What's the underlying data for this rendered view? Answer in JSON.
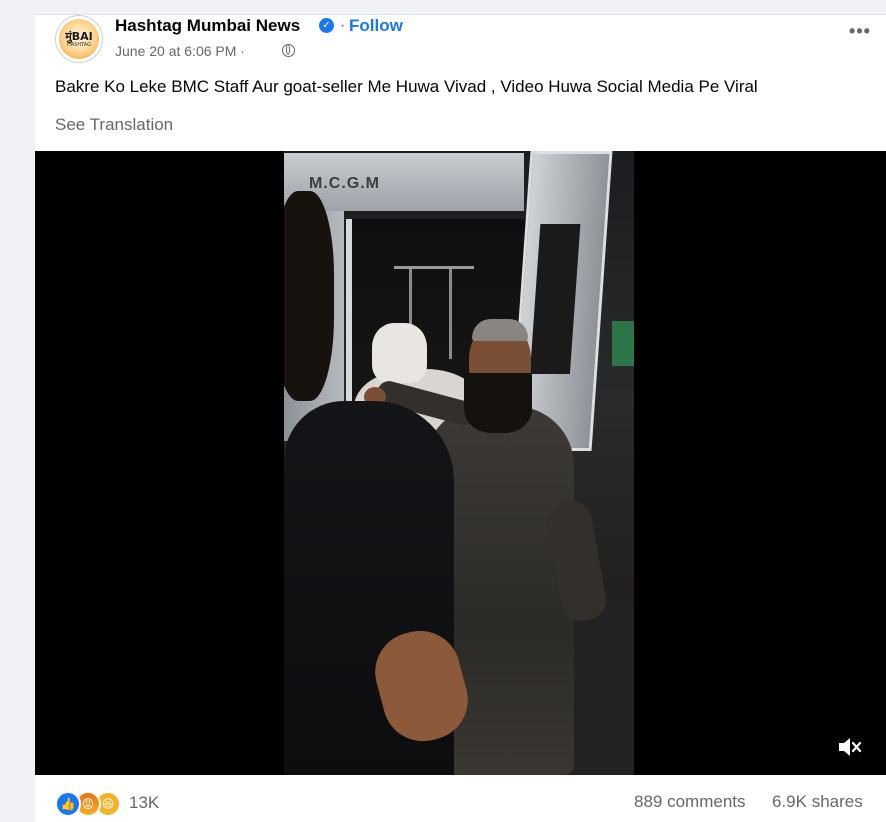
{
  "post": {
    "page_name": "Hashtag Mumbai News",
    "follow_label": "Follow",
    "separator": "·",
    "timestamp": "June 20 at 6:06 PM ·",
    "text": "Bakre Ko Leke BMC Staff Aur goat-seller Me Huwa Vivad , Video Huwa Social Media Pe Viral",
    "see_translation": "See Translation",
    "more_label": "•••",
    "avatar_text": "मुंBAI",
    "avatar_subtext": "HASHTAG"
  },
  "video": {
    "van_label": "M.C.G.M",
    "muted": true
  },
  "footer": {
    "reaction_count": "13K",
    "comments": "889 comments",
    "shares": "6.9K shares",
    "reaction_icons": [
      "like-icon",
      "angry-icon",
      "haha-icon"
    ]
  },
  "colors": {
    "accent": "#1877f2",
    "secondary_text": "#65676b",
    "primary_text": "#050505"
  }
}
